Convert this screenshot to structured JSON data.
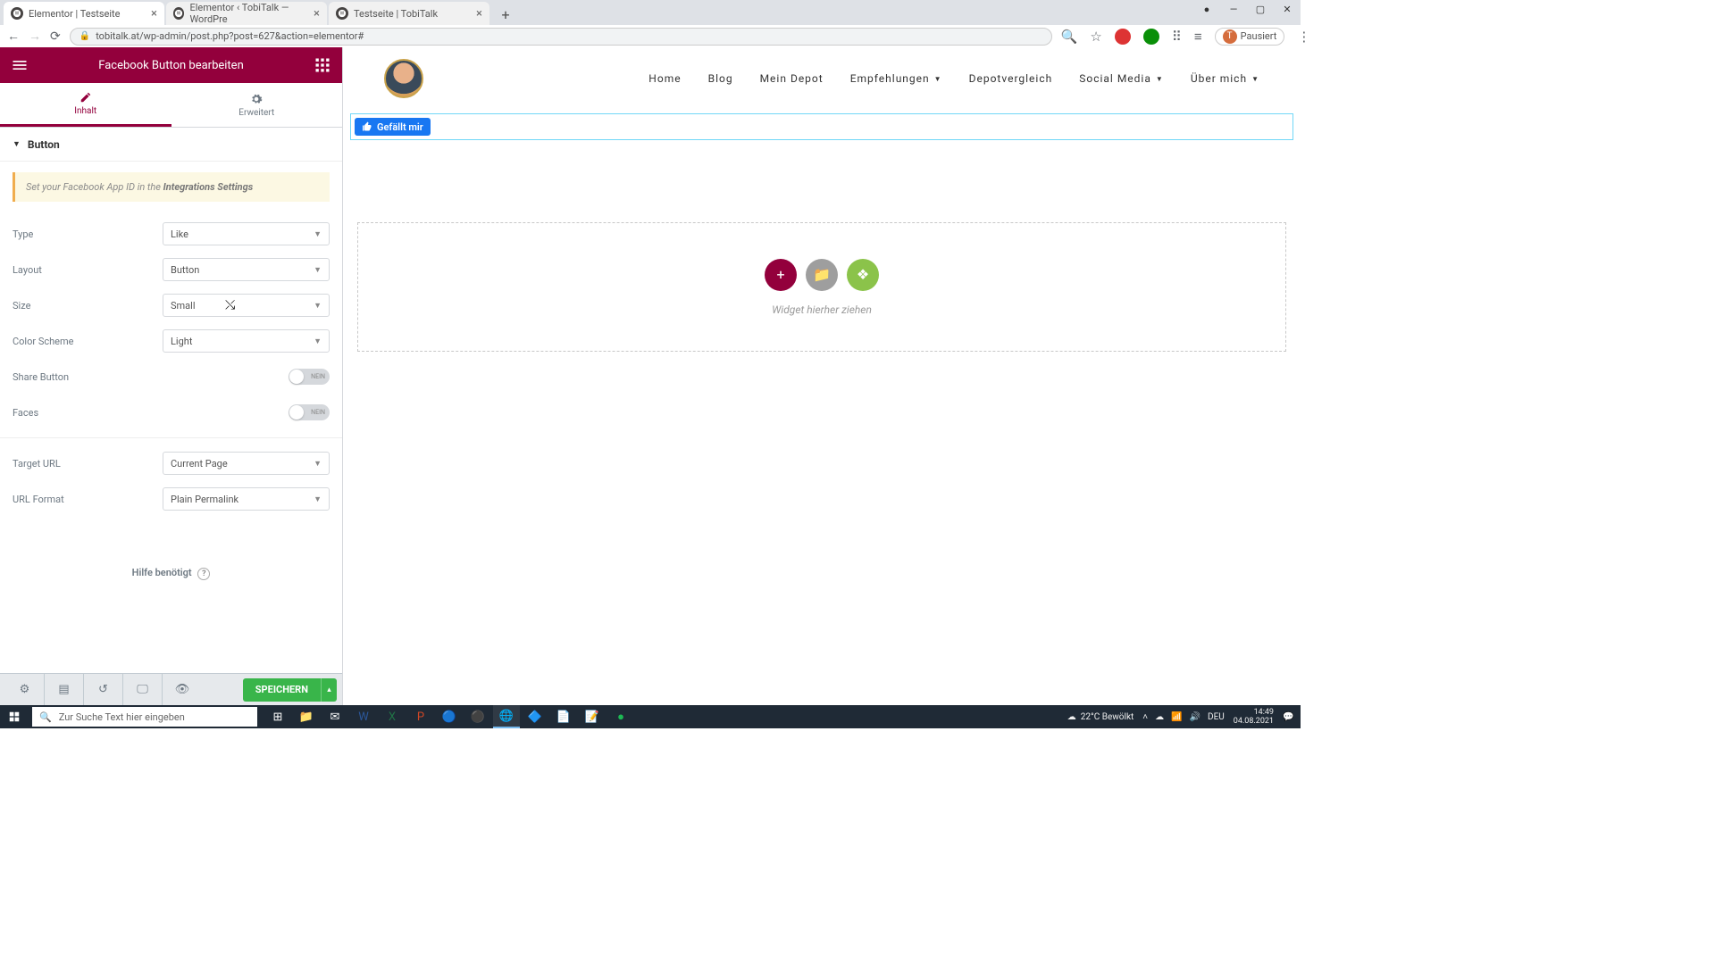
{
  "browser": {
    "tabs": [
      {
        "title": "Elementor | Testseite",
        "active": true
      },
      {
        "title": "Elementor ‹ TobiTalk — WordPre",
        "active": false
      },
      {
        "title": "Testseite | TobiTalk",
        "active": false
      }
    ],
    "url": "tobitalk.at/wp-admin/post.php?post=627&action=elementor#",
    "profile_label": "Pausiert",
    "profile_initial": "T"
  },
  "elementor": {
    "header_title": "Facebook Button bearbeiten",
    "tabs": {
      "content": "Inhalt",
      "advanced": "Erweitert"
    },
    "section_title": "Button",
    "notice_prefix": "Set your Facebook App ID in the ",
    "notice_link": "Integrations Settings",
    "controls": {
      "type": {
        "label": "Type",
        "value": "Like"
      },
      "layout": {
        "label": "Layout",
        "value": "Button"
      },
      "size": {
        "label": "Size",
        "value": "Small"
      },
      "color": {
        "label": "Color Scheme",
        "value": "Light"
      },
      "share": {
        "label": "Share Button",
        "value": "NEIN"
      },
      "faces": {
        "label": "Faces",
        "value": "NEIN"
      },
      "target": {
        "label": "Target URL",
        "value": "Current Page"
      },
      "format": {
        "label": "URL Format",
        "value": "Plain Permalink"
      }
    },
    "help": "Hilfe benötigt",
    "save": "SPEICHERN"
  },
  "site": {
    "nav": [
      "Home",
      "Blog",
      "Mein Depot",
      "Empfehlungen",
      "Depotvergleich",
      "Social Media",
      "Über mich"
    ],
    "fb_like": "Gefällt mir",
    "dropzone": "Widget hierher ziehen"
  },
  "taskbar": {
    "search_placeholder": "Zur Suche Text hier eingeben",
    "weather": "22°C  Bewölkt",
    "lang": "DEU",
    "time": "14:49",
    "date": "04.08.2021"
  }
}
